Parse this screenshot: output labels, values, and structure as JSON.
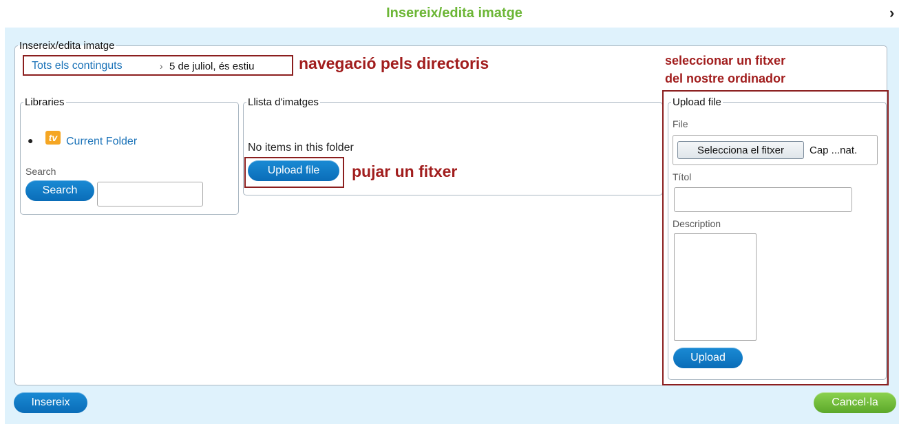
{
  "dialog": {
    "title": "Insereix/edita imatge",
    "close_glyph": "›"
  },
  "main_fieldset": {
    "legend": "Insereix/edita imatge"
  },
  "breadcrumb": {
    "root": "Tots els continguts",
    "separator": "›",
    "current": "5 de juliol, és estiu"
  },
  "annotations": {
    "navigation": "navegació pels directoris",
    "select_file_line1": "seleccionar un fitxer",
    "select_file_line2": "del nostre ordinador",
    "upload_a_file": "pujar un fitxer"
  },
  "libraries": {
    "legend": "Libraries",
    "items": [
      {
        "label": "Current Folder",
        "icon": "folder-tv-icon"
      }
    ],
    "search_label": "Search",
    "search_button": "Search",
    "search_value": ""
  },
  "image_list": {
    "legend": "Llista d'imatges",
    "empty_message": "No items in this folder",
    "upload_button": "Upload file"
  },
  "upload_panel": {
    "legend": "Upload file",
    "file_label": "File",
    "choose_button": "Selecciona el fitxer",
    "no_file_text": "Cap ...nat.",
    "title_label": "Títol",
    "title_value": "",
    "description_label": "Description",
    "description_value": "",
    "upload_button": "Upload"
  },
  "footer": {
    "insert_button": "Insereix",
    "cancel_button": "Cancel·la"
  },
  "colors": {
    "title_green": "#6cb636",
    "body_blue": "#dff2fc",
    "button_blue": "#0a6db8",
    "button_green": "#5ca82a",
    "annotation_red": "#a11d1d"
  }
}
